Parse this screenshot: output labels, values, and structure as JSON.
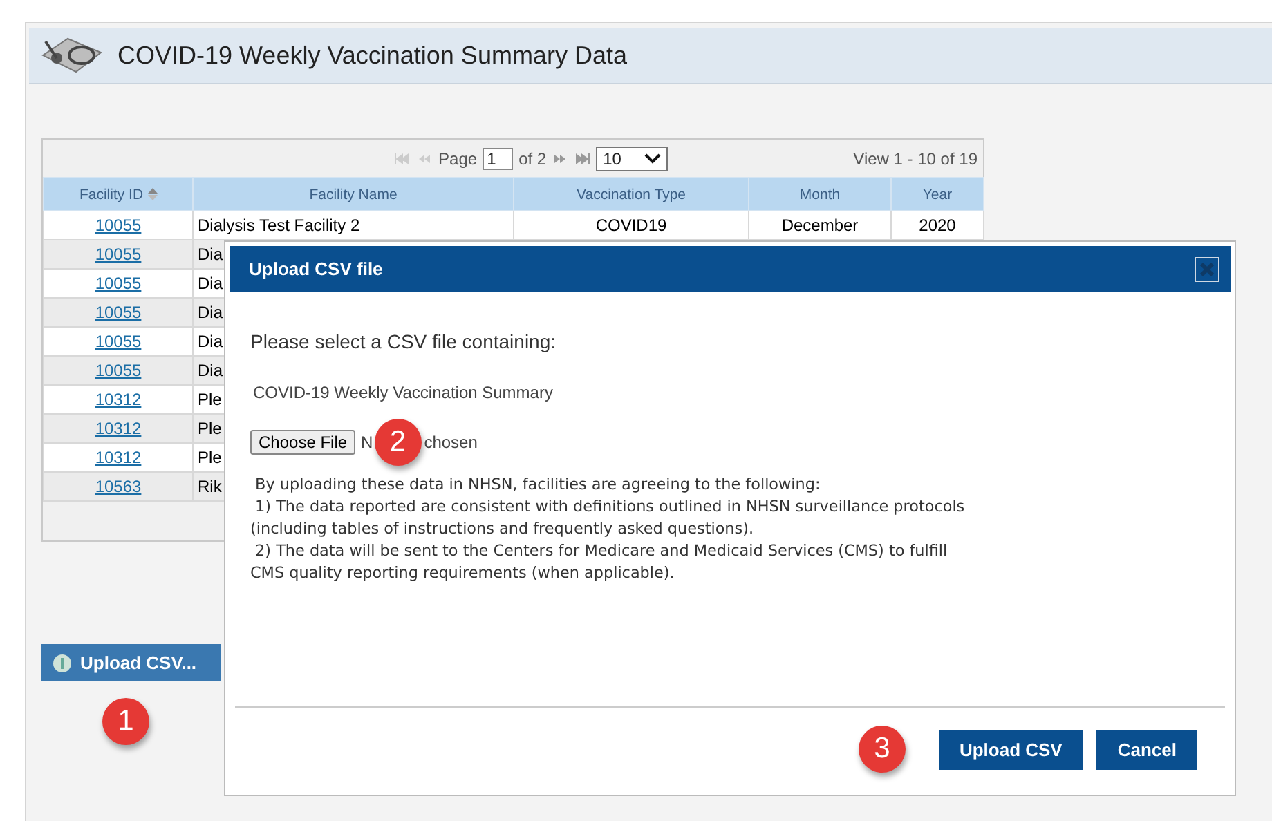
{
  "page": {
    "title": "COVID-19 Weekly Vaccination Summary Data"
  },
  "pager": {
    "page_label": "Page",
    "page_value": "1",
    "of_label": "of 2",
    "rows_per_page": "10",
    "view_label": "View 1 - 10 of 19"
  },
  "table": {
    "columns": [
      {
        "label": "Facility ID",
        "sorted": true
      },
      {
        "label": "Facility Name",
        "sorted": false
      },
      {
        "label": "Vaccination Type",
        "sorted": false
      },
      {
        "label": "Month",
        "sorted": false
      },
      {
        "label": "Year",
        "sorted": false
      }
    ],
    "rows": [
      {
        "facility_id": "10055",
        "facility_name": "Dialysis Test Facility 2",
        "vaccination_type": "COVID19",
        "month": "December",
        "year": "2020"
      },
      {
        "facility_id": "10055",
        "facility_name": "Dia"
      },
      {
        "facility_id": "10055",
        "facility_name": "Dia"
      },
      {
        "facility_id": "10055",
        "facility_name": "Dia"
      },
      {
        "facility_id": "10055",
        "facility_name": "Dia"
      },
      {
        "facility_id": "10055",
        "facility_name": "Dia"
      },
      {
        "facility_id": "10312",
        "facility_name": "Ple"
      },
      {
        "facility_id": "10312",
        "facility_name": "Ple"
      },
      {
        "facility_id": "10312",
        "facility_name": "Ple"
      },
      {
        "facility_id": "10563",
        "facility_name": "Rik"
      }
    ]
  },
  "upload_button": {
    "label": "Upload CSV..."
  },
  "dialog": {
    "title": "Upload CSV file",
    "heading": "Please select a CSV file containing:",
    "file_type": "COVID-19 Weekly Vaccination Summary",
    "choose_file": "Choose File",
    "file_status_start": "N",
    "file_status_end": "chosen",
    "notice": " By uploading these data in NHSN, facilities are agreeing to the following:\n 1) The data reported are consistent with definitions outlined in NHSN surveillance protocols\n(including tables of instructions and frequently asked questions).\n 2) The data will be sent to the Centers for Medicare and Medicaid Services (CMS) to fulfill\nCMS quality reporting requirements (when applicable).",
    "buttons": [
      "Upload CSV",
      "Cancel"
    ]
  },
  "callouts": [
    "1",
    "2",
    "3"
  ]
}
